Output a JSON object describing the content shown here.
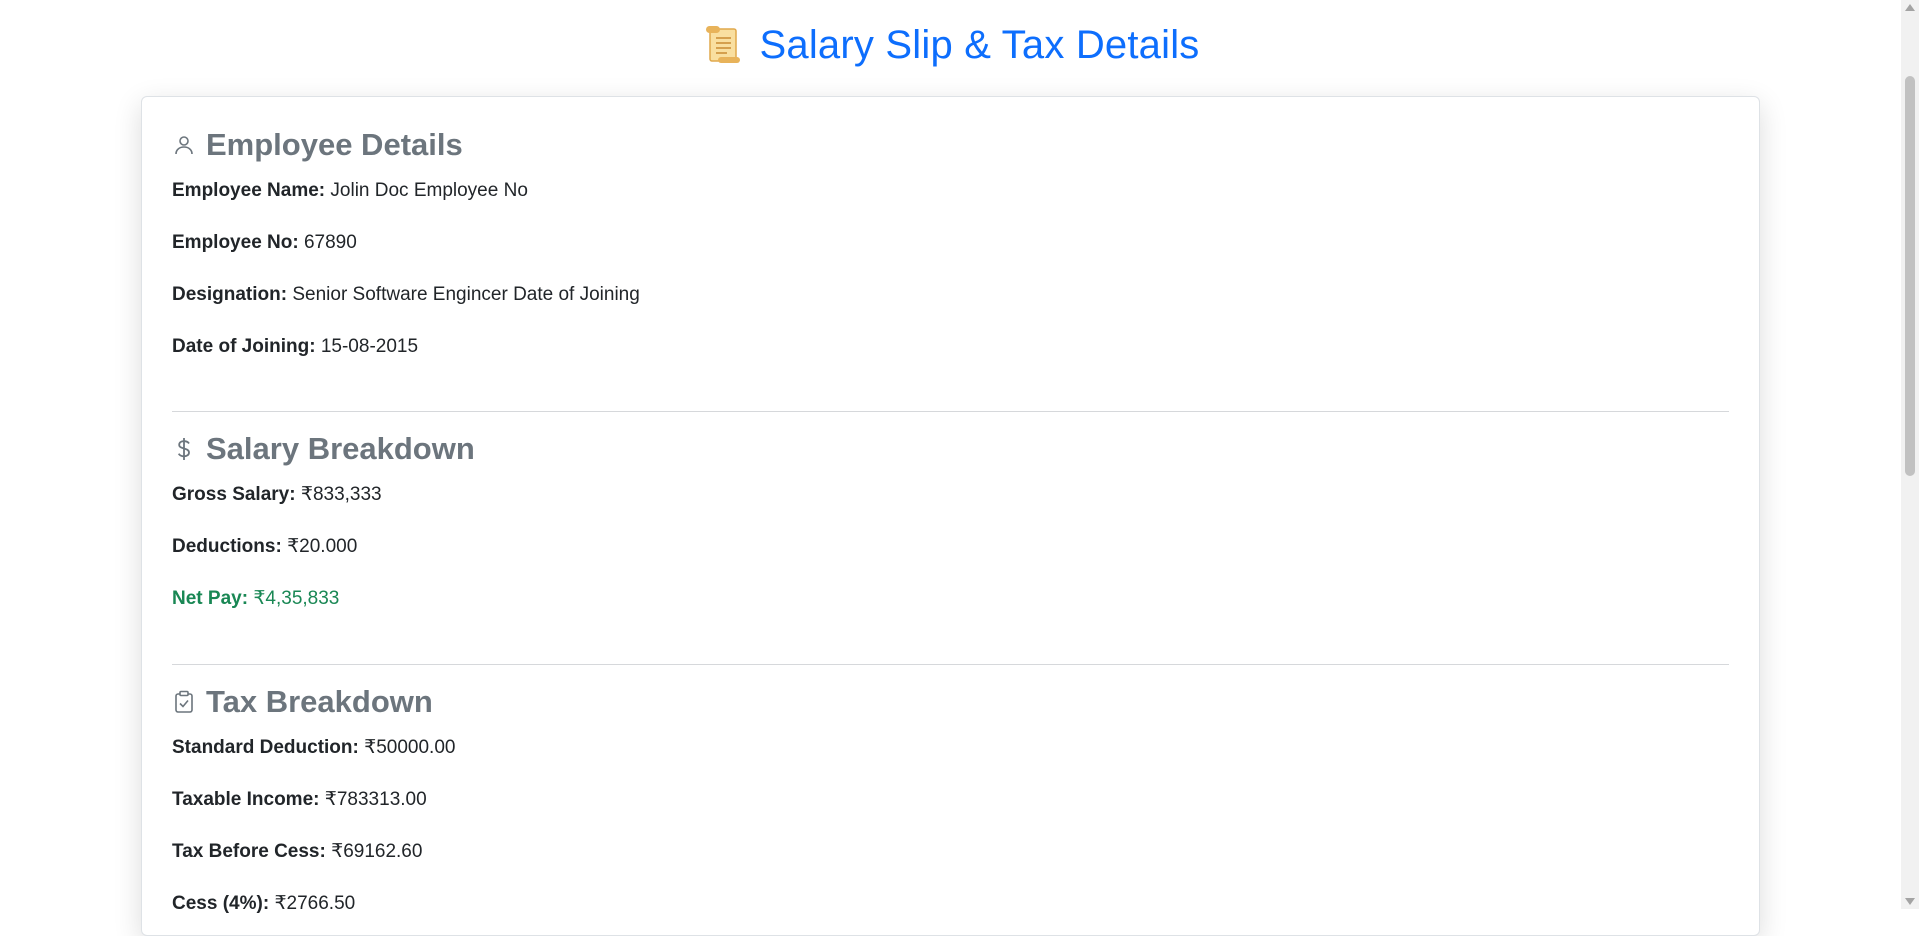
{
  "page": {
    "title": "Salary Slip & Tax Details",
    "title_icon": "scroll-icon",
    "accent_color": "#0d6efd",
    "green_color": "#198754"
  },
  "employee": {
    "heading": "Employee Details",
    "icon": "person-icon",
    "name_label": "Employee Name:",
    "name_value": "Jolin Doc Employee No",
    "no_label": "Employee No:",
    "no_value": "67890",
    "designation_label": "Designation:",
    "designation_value": "Senior Software Engincer Date of Joining",
    "doj_label": "Date of Joining:",
    "doj_value": "15-08-2015"
  },
  "salary": {
    "heading": "Salary Breakdown",
    "icon": "dollar-icon",
    "gross_label": "Gross Salary:",
    "gross_value": "₹833,333",
    "deductions_label": "Deductions:",
    "deductions_value": "₹20.000",
    "net_label": "Net Pay:",
    "net_value": "₹4,35,833"
  },
  "tax": {
    "heading": "Tax Breakdown",
    "icon": "clipboard-check-icon",
    "std_label": "Standard Deduction:",
    "std_value": "₹50000.00",
    "taxable_label": "Taxable Income:",
    "taxable_value": "₹783313.00",
    "before_cess_label": "Tax Before Cess:",
    "before_cess_value": "₹69162.60",
    "cess_label": "Cess (4%):",
    "cess_value": "₹2766.50"
  }
}
